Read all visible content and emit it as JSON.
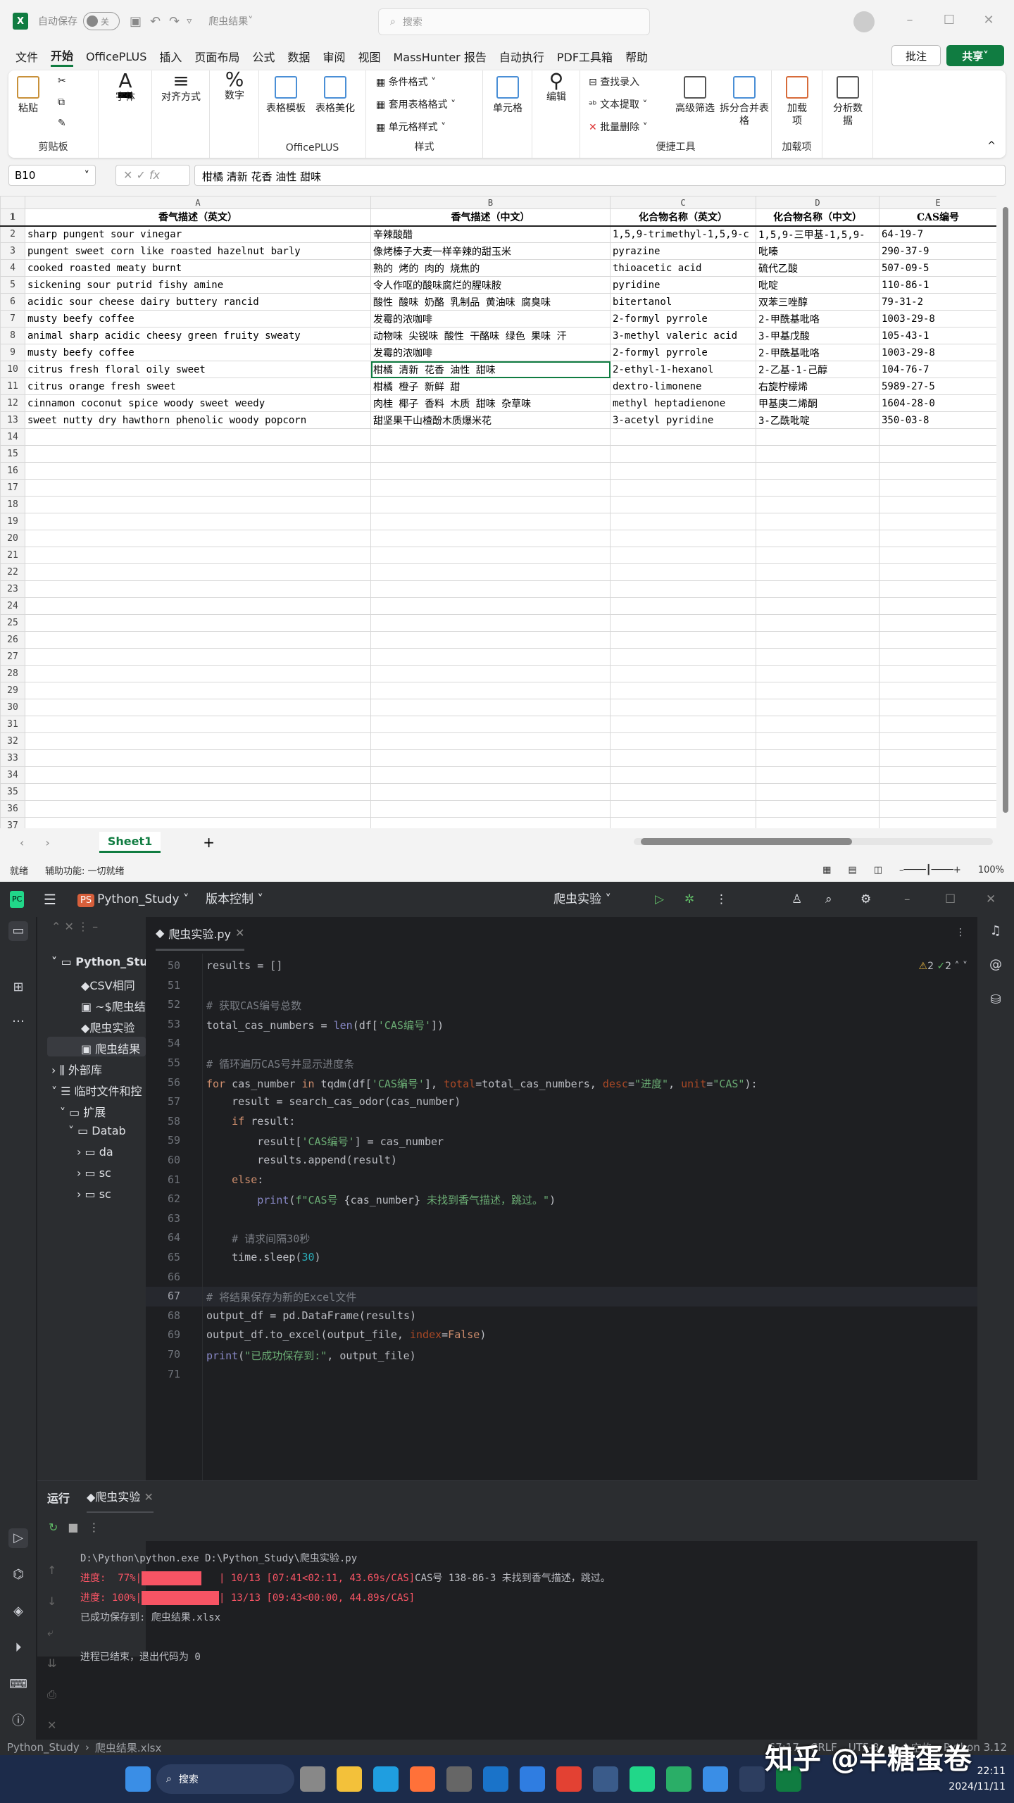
{
  "excel": {
    "autosave_label": "自动保存",
    "autosave_state": "关",
    "doc_title": "爬虫结果",
    "search_placeholder": "搜索",
    "tabs": [
      "文件",
      "开始",
      "OfficePLUS",
      "插入",
      "页面布局",
      "公式",
      "数据",
      "审阅",
      "视图",
      "MassHunter 报告",
      "自动执行",
      "PDF工具箱",
      "帮助"
    ],
    "comment_label": "批注",
    "share_label": "共享",
    "ribbon": {
      "paste": "粘贴",
      "clipboard": "剪贴板",
      "font": "字体",
      "align": "对齐方式",
      "number": "数字",
      "tpl": "表格模板",
      "beautify": "表格美化",
      "officeplus": "OfficePLUS",
      "cond": "条件格式",
      "table_fmt": "套用表格格式",
      "cell_style": "单元格样式",
      "styles": "样式",
      "cells": "单元格",
      "edit": "编辑",
      "find": "查找录入",
      "extract": "文本提取",
      "batch_del": "批量删除",
      "adv_filter": "高级筛选",
      "split_merge": "拆分合并表格",
      "tools": "便捷工具",
      "addin": "加载项",
      "addin_grp": "加载项",
      "analyze": "分析数据"
    },
    "name_box": "B10",
    "formula": "柑橘 清新 花香 油性 甜味",
    "columns": [
      "A",
      "B",
      "C",
      "D",
      "E"
    ],
    "header": [
      "香气描述（英文）",
      "香气描述（中文）",
      "化合物名称（英文）",
      "化合物名称（中文）",
      "CAS编号"
    ],
    "rows": [
      [
        "sharp pungent sour vinegar",
        "辛辣酸醋",
        "1,5,9-trimethyl-1,5,9-c",
        "1,5,9-三甲基-1,5,9-",
        "64-19-7"
      ],
      [
        "pungent sweet corn like roasted hazelnut barly",
        "像烤榛子大麦一样辛辣的甜玉米",
        "pyrazine",
        "吡嗪",
        "290-37-9"
      ],
      [
        "cooked roasted meaty burnt",
        "熟的 烤的 肉的 烧焦的",
        "thioacetic acid",
        "硫代乙酸",
        "507-09-5"
      ],
      [
        "sickening sour putrid fishy amine",
        "令人作呕的酸味腐烂的腥味胺",
        "pyridine",
        "吡啶",
        "110-86-1"
      ],
      [
        "acidic sour cheese dairy buttery rancid",
        "酸性 酸味 奶酪 乳制品 黄油味 腐臭味",
        "bitertanol",
        "双苯三唑醇",
        "79-31-2"
      ],
      [
        "musty beefy coffee",
        "发霉的浓咖啡",
        "2-formyl pyrrole",
        "2-甲酰基吡咯",
        "1003-29-8"
      ],
      [
        "animal sharp acidic cheesy green fruity sweaty",
        "动物味 尖锐味 酸性 干酪味 绿色 果味 汗",
        "3-methyl valeric acid",
        "3-甲基戊酸",
        "105-43-1"
      ],
      [
        "musty beefy coffee",
        "发霉的浓咖啡",
        "2-formyl pyrrole",
        "2-甲酰基吡咯",
        "1003-29-8"
      ],
      [
        "citrus fresh floral oily sweet",
        "柑橘 清新 花香 油性 甜味",
        "2-ethyl-1-hexanol",
        "2-乙基-1-己醇",
        "104-76-7"
      ],
      [
        "citrus orange fresh sweet",
        "柑橘 橙子 新鲜 甜",
        "dextro-limonene",
        "右旋柠檬烯",
        "5989-27-5"
      ],
      [
        "cinnamon coconut spice woody sweet weedy",
        "肉桂 椰子 香料 木质 甜味 杂草味",
        "methyl heptadienone",
        "甲基庚二烯酮",
        "1604-28-0"
      ],
      [
        "sweet nutty dry hawthorn phenolic woody popcorn",
        "甜坚果干山楂酚木质爆米花",
        "3-acetyl pyridine",
        "3-乙酰吡啶",
        "350-03-8"
      ]
    ],
    "total_rows": 37,
    "sheet_tab": "Sheet1",
    "status_ready": "就绪",
    "status_access": "辅助功能: 一切就绪",
    "zoom": "100%"
  },
  "pycharm": {
    "project": "Python_Study",
    "vcs": "版本控制",
    "run_config": "爬虫实验",
    "editor_tab": "爬虫实验.py",
    "inspections": {
      "warnings": "2",
      "ok": "2"
    },
    "tree": [
      {
        "label": "Python_Study"
      },
      {
        "label": "CSV相同"
      },
      {
        "label": "~$爬虫结"
      },
      {
        "label": "爬虫实验"
      },
      {
        "label": "爬虫结果"
      },
      {
        "label": "外部库"
      },
      {
        "label": "临时文件和控"
      },
      {
        "label": "扩展"
      },
      {
        "label": "Datab"
      },
      {
        "label": "da"
      },
      {
        "label": "sc"
      },
      {
        "label": "sc"
      }
    ],
    "first_line": 50,
    "current_line": 67,
    "code": [
      [
        [
          "results = []",
          ""
        ]
      ],
      [],
      [
        [
          "# 获取CAS编号总数",
          "cm"
        ]
      ],
      [
        [
          "total_cas_numbers = ",
          ""
        ],
        [
          "len",
          "bi"
        ],
        [
          "(df[",
          ""
        ],
        [
          "'CAS编号'",
          "str"
        ],
        [
          "])",
          ""
        ]
      ],
      [],
      [
        [
          "# 循环遍历CAS号并显示进度条",
          "cm"
        ]
      ],
      [
        [
          "for",
          "kw"
        ],
        [
          " cas_number ",
          ""
        ],
        [
          "in",
          "kw"
        ],
        [
          " tqdm(df[",
          ""
        ],
        [
          "'CAS编号'",
          "str"
        ],
        [
          "], ",
          ""
        ],
        [
          "total",
          "pr"
        ],
        [
          "=total_cas_numbers, ",
          ""
        ],
        [
          "desc",
          "pr"
        ],
        [
          "=",
          ""
        ],
        [
          "\"进度\"",
          "str"
        ],
        [
          ", ",
          ""
        ],
        [
          "unit",
          "pr"
        ],
        [
          "=",
          ""
        ],
        [
          "\"CAS\"",
          "str"
        ],
        [
          "):",
          ""
        ]
      ],
      [
        [
          "    result = search_cas_odor(cas_number)",
          ""
        ]
      ],
      [
        [
          "    ",
          ""
        ],
        [
          "if",
          "kw"
        ],
        [
          " result:",
          ""
        ]
      ],
      [
        [
          "        result[",
          ""
        ],
        [
          "'CAS编号'",
          "str"
        ],
        [
          "] = cas_number",
          ""
        ]
      ],
      [
        [
          "        results.append(result)",
          ""
        ]
      ],
      [
        [
          "    ",
          ""
        ],
        [
          "else",
          "kw"
        ],
        [
          ":",
          ""
        ]
      ],
      [
        [
          "        ",
          ""
        ],
        [
          "print",
          "bi"
        ],
        [
          "(",
          ""
        ],
        [
          "f\"CAS号 ",
          "str"
        ],
        [
          "{cas_number}",
          ""
        ],
        [
          " 未找到香气描述，跳过。\"",
          "str"
        ],
        [
          ")",
          ""
        ]
      ],
      [],
      [
        [
          "    # 请求间隔30秒",
          "cm"
        ]
      ],
      [
        [
          "    time.sleep(",
          ""
        ],
        [
          "30",
          "num"
        ],
        [
          ")",
          ""
        ]
      ],
      [],
      [
        [
          "# 将结果保存为新的Excel文件",
          "cm"
        ]
      ],
      [
        [
          "output_df = pd.DataFrame(results)",
          ""
        ]
      ],
      [
        [
          "output_df.to_excel(output_file, ",
          ""
        ],
        [
          "index",
          "pr"
        ],
        [
          "=",
          ""
        ],
        [
          "False",
          "kw"
        ],
        [
          ")",
          ""
        ]
      ],
      [
        [
          "print",
          "bi"
        ],
        [
          "(",
          ""
        ],
        [
          "\"已成功保存到:\"",
          "str"
        ],
        [
          ", output_file)",
          ""
        ]
      ],
      []
    ],
    "run_tab": "运行",
    "run_file": "爬虫实验",
    "output": {
      "cmd": "D:\\Python\\python.exe D:\\Python_Study\\爬虫实验.py",
      "p1_label": "进度:  77%|",
      "p1_value": 77,
      "p1_rest": "   | 10/13 [07:41<02:11, 43.69s/CAS]",
      "p1_msg": "CAS号 138-86-3 未找到香气描述，跳过。",
      "p2_label": "进度: 100%|",
      "p2_value": 100,
      "p2_rest": "| 13/13 [09:43<00:00, 44.89s/CAS]",
      "saved": "已成功保存到: 爬虫结果.xlsx",
      "exit": "进程已结束，退出代码为 0"
    },
    "status": {
      "crumb_project": "Python_Study",
      "crumb_file": "爬虫结果.xlsx",
      "position": "67:17",
      "line_sep": "CRLF",
      "encoding": "UTF-8",
      "indent": "4 个空格",
      "interpreter": "Python 3.12"
    }
  },
  "taskbar": {
    "search": "搜索",
    "time": "22:11",
    "date": "2024/11/11"
  },
  "watermark": "知乎 @半糖蛋卷"
}
